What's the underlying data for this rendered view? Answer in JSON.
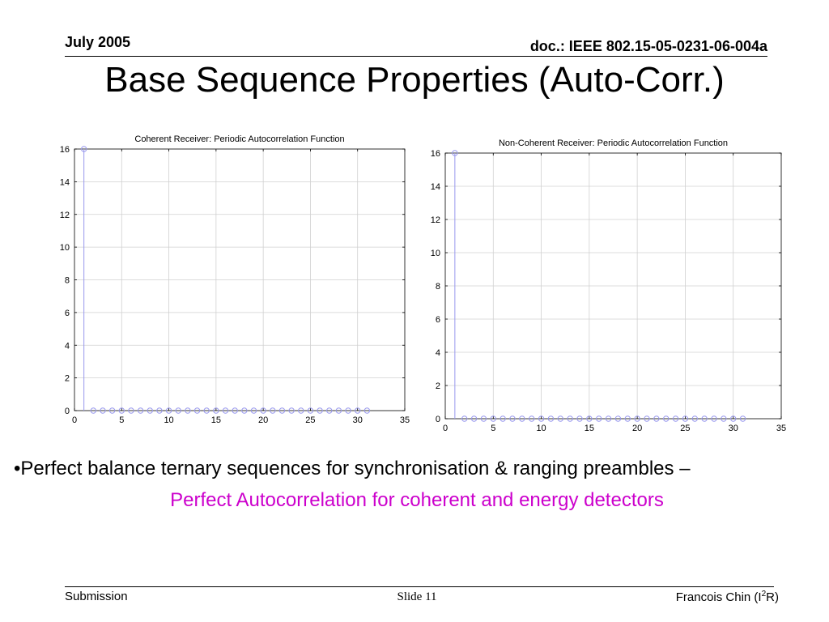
{
  "header": {
    "date": "July 2005",
    "doc": "doc.: IEEE 802.15-05-0231-06-004a"
  },
  "title": "Base Sequence Properties (Auto-Corr.)",
  "chart_data": [
    {
      "type": "scatter",
      "title": "Coherent Receiver: Periodic Autocorrelation Function",
      "xlabel": "",
      "ylabel": "",
      "xlim": [
        0,
        35
      ],
      "ylim": [
        0,
        16
      ],
      "xticks": [
        0,
        5,
        10,
        15,
        20,
        25,
        30,
        35
      ],
      "yticks": [
        0,
        2,
        4,
        6,
        8,
        10,
        12,
        14,
        16
      ],
      "grid": true,
      "marker": "circle",
      "series_color": "#9999ee",
      "x": [
        1,
        2,
        3,
        4,
        5,
        6,
        7,
        8,
        9,
        10,
        11,
        12,
        13,
        14,
        15,
        16,
        17,
        18,
        19,
        20,
        21,
        22,
        23,
        24,
        25,
        26,
        27,
        28,
        29,
        30,
        31
      ],
      "y": [
        16,
        0,
        0,
        0,
        0,
        0,
        0,
        0,
        0,
        0,
        0,
        0,
        0,
        0,
        0,
        0,
        0,
        0,
        0,
        0,
        0,
        0,
        0,
        0,
        0,
        0,
        0,
        0,
        0,
        0,
        0
      ]
    },
    {
      "type": "scatter",
      "title": "Non-Coherent Receiver: Periodic Autocorrelation Function",
      "xlabel": "",
      "ylabel": "",
      "xlim": [
        0,
        35
      ],
      "ylim": [
        0,
        16
      ],
      "xticks": [
        0,
        5,
        10,
        15,
        20,
        25,
        30,
        35
      ],
      "yticks": [
        0,
        2,
        4,
        6,
        8,
        10,
        12,
        14,
        16
      ],
      "grid": true,
      "marker": "circle",
      "series_color": "#9999ee",
      "x": [
        1,
        2,
        3,
        4,
        5,
        6,
        7,
        8,
        9,
        10,
        11,
        12,
        13,
        14,
        15,
        16,
        17,
        18,
        19,
        20,
        21,
        22,
        23,
        24,
        25,
        26,
        27,
        28,
        29,
        30,
        31
      ],
      "y": [
        16,
        0,
        0,
        0,
        0,
        0,
        0,
        0,
        0,
        0,
        0,
        0,
        0,
        0,
        0,
        0,
        0,
        0,
        0,
        0,
        0,
        0,
        0,
        0,
        0,
        0,
        0,
        0,
        0,
        0,
        0
      ]
    }
  ],
  "body": {
    "bullet1": "•Perfect balance ternary sequences for synchronisation & ranging preambles –",
    "bullet2": "Perfect Autocorrelation for coherent and energy detectors"
  },
  "footer": {
    "left": "Submission",
    "center": "Slide 11",
    "right_prefix": "Francois Chin (I",
    "right_sup": "2",
    "right_suffix": "R)"
  }
}
